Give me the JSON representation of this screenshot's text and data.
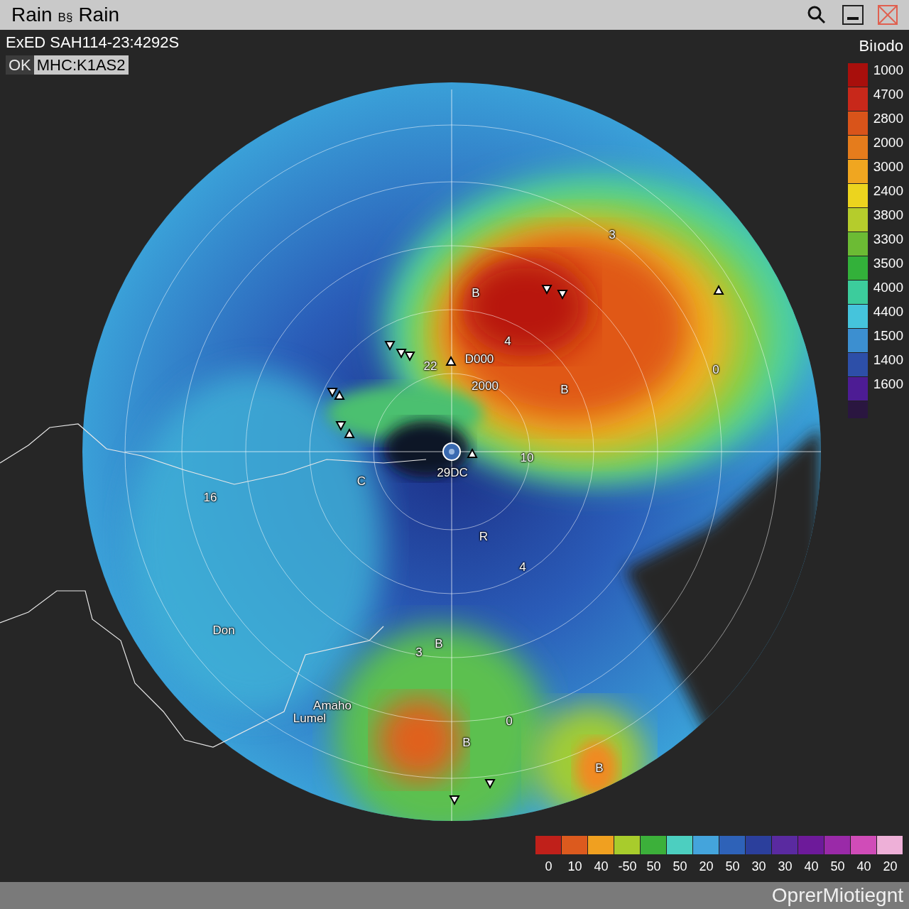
{
  "window": {
    "title": "Rain",
    "title_badge": "B§",
    "title_suffix": "Rain"
  },
  "station": {
    "line": "ExED SAH114-23:4292S",
    "status": "OK",
    "code": "MHC:K1AS2"
  },
  "map_labels": [
    "B",
    "3",
    "4",
    "22",
    "D000",
    "2000",
    "B",
    "0",
    "10",
    "29DC",
    "C",
    "16",
    "R",
    "4",
    "Don",
    "B",
    "3",
    "Amaho",
    "Lumel",
    "0",
    "B",
    "B"
  ],
  "legend": {
    "title": "Biıodo",
    "items": [
      {
        "label": "1000",
        "color": "#a80f0c"
      },
      {
        "label": "4700",
        "color": "#c8281a"
      },
      {
        "label": "2800",
        "color": "#d9541a"
      },
      {
        "label": "2000",
        "color": "#e57c1c"
      },
      {
        "label": "3000",
        "color": "#f0a620"
      },
      {
        "label": "2400",
        "color": "#ecd41e"
      },
      {
        "label": "3800",
        "color": "#b5cc2c"
      },
      {
        "label": "3300",
        "color": "#6cbb34"
      },
      {
        "label": "3500",
        "color": "#33b13a"
      },
      {
        "label": "4000",
        "color": "#3ccc9c"
      },
      {
        "label": "4400",
        "color": "#45c4dc"
      },
      {
        "label": "1500",
        "color": "#3c8fd0"
      },
      {
        "label": "1400",
        "color": "#2d4fa8"
      },
      {
        "label": "1600",
        "color": "#4d1c94"
      }
    ]
  },
  "scale": {
    "items": [
      {
        "label": "0",
        "color": "#c0201a"
      },
      {
        "label": "10",
        "color": "#dc5a1e"
      },
      {
        "label": "40",
        "color": "#f0a020"
      },
      {
        "label": "-50",
        "color": "#a8cc2c"
      },
      {
        "label": "50",
        "color": "#3cb03a"
      },
      {
        "label": "50",
        "color": "#4ccfc0"
      },
      {
        "label": "20",
        "color": "#44a4dc"
      },
      {
        "label": "50",
        "color": "#2e62b8"
      },
      {
        "label": "30",
        "color": "#2b3f9c"
      },
      {
        "label": "30",
        "color": "#5a2aa0"
      },
      {
        "label": "40",
        "color": "#6d1a9a"
      },
      {
        "label": "50",
        "color": "#9a2aa8"
      },
      {
        "label": "40",
        "color": "#d04cb8"
      },
      {
        "label": "20",
        "color": "#eeb0d8"
      }
    ]
  },
  "status_bar": {
    "text": "OprerMiotiegnt"
  }
}
